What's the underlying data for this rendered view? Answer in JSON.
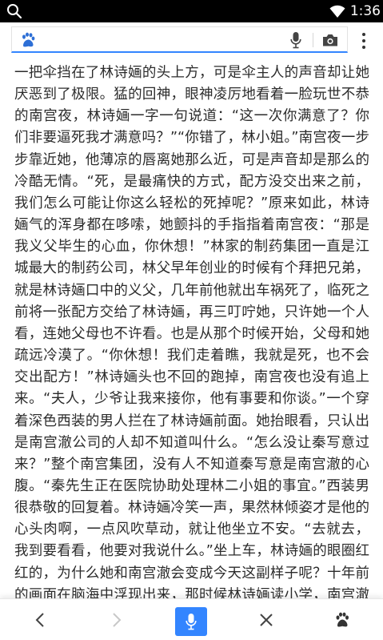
{
  "status_bar": {
    "time": "1:36",
    "icons": [
      "search-icon",
      "wifi-icon",
      "battery-icon"
    ]
  },
  "search": {
    "value": "",
    "placeholder": "",
    "icons": [
      "baidu-paw-icon",
      "microphone-icon",
      "camera-icon",
      "more-vertical-icon"
    ]
  },
  "article": {
    "text": "一把伞挡在了林诗婳的头上方，可是伞主人的声音却让她厌恶到了极限。猛的回神，眼神凌厉地看着一脸玩世不恭的南宫夜，林诗婳一字一句说道：“这一次你满意了？你们非要逼死我才满意吗？”“你错了，林小姐。”南宫夜一步步靠近她，他薄凉的唇离她那么近，可是声音却是那么的冷酷无情。“死，是最痛快的方式，配方没交出来之前，我们怎么可能让你这么轻松的死掉呢？”原来如此，林诗婳气的浑身都在哆嗦，她颤抖的手指指着南宫夜：“那是 我义父毕生的心血，你休想！”林家的制药集团一直是江城最大的制药公司，林父早年创业的时候有个拜把兄弟，就是林诗婳口中的义父，几年前他就出车祸死了，临死之前将一张配方交给了林诗婳，再三叮咛她，只许她一个人看，连她父母也不许看。也是从那个时候开始，父母和她疏远冷漠了。“你休想！我们走着瞧，我就是死，也不会交出配方！”林诗婳头也不回的跑掉，南宫夜也没有追上来。“夫人，少爷让我来接你，他有事要和你谈。”一个穿着深色西装的男人拦在了林诗婳前面。她抬眼看，只认出是南宫澈公司的人却不知道叫什么。“怎么没让秦写意过来？”整个南宫集团，没有人不知道秦写意是南宫澈的心腹。“秦先生正在医院协助处理林二小姐的事宜。”西装男很恭敬的回复着。林诗婳冷笑一声，果然林倾姿才是他的心头肉啊，一点风吹草动，就让他坐立不安。“去就去，我到要看看，他要对我说什么。”坐上车，林诗婳的眼圈红红的，为什么她和南宫澈会变成今天这副样子呢？十年前的画面在脑海中浮现出来，那时候林诗婳读小学，南宫澈和林倾姿读初中，二人在同一所学校。"
  },
  "bottom_nav": {
    "items": [
      "back-arrow-icon",
      "forward-arrow-icon",
      "microphone-icon",
      "close-icon",
      "baidu-paw-icon"
    ]
  },
  "colors": {
    "accent": "#3385ff",
    "status_bar_bg": "#000000",
    "text": "#2b2b2b",
    "disabled": "#c8c8c8"
  }
}
